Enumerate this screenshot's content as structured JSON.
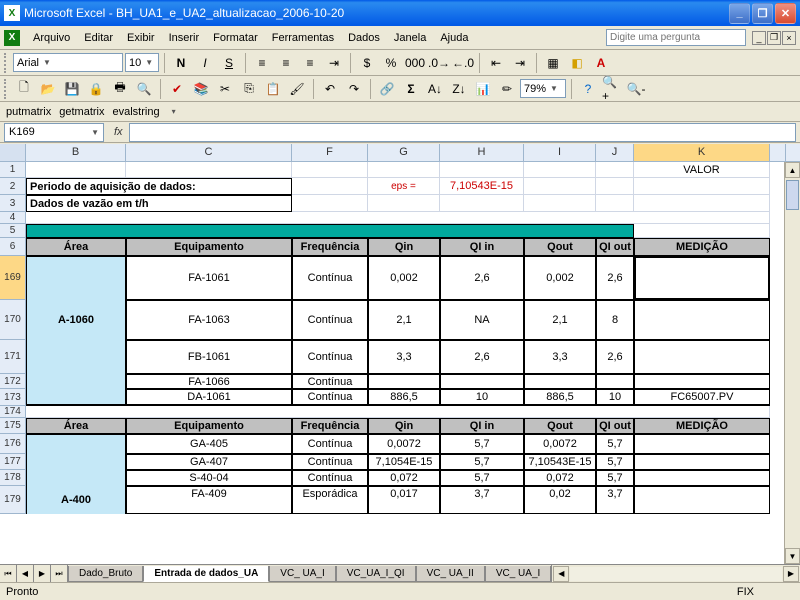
{
  "titlebar": {
    "app": "Microsoft Excel",
    "doc": "BH_UA1_e_UA2_altualizacao_2006-10-20"
  },
  "menu": {
    "arquivo": "Arquivo",
    "editar": "Editar",
    "exibir": "Exibir",
    "inserir": "Inserir",
    "formatar": "Formatar",
    "ferramentas": "Ferramentas",
    "dados": "Dados",
    "janela": "Janela",
    "ajuda": "Ajuda",
    "help_placeholder": "Digite uma pergunta"
  },
  "format_toolbar": {
    "font": "Arial",
    "size": "10"
  },
  "std_toolbar": {
    "zoom": "79%"
  },
  "custom_bar": {
    "a": "putmatrix",
    "b": "getmatrix",
    "c": "evalstring"
  },
  "namebox": "K169",
  "fx": "fx",
  "col_headers": [
    "B",
    "C",
    "F",
    "G",
    "H",
    "I",
    "J",
    "K"
  ],
  "rows": {
    "r1": {
      "k": "VALOR"
    },
    "r2": {
      "b": "Periodo de aquisição de dados:",
      "g": "eps =",
      "h": "7,10543E-15"
    },
    "r3": {
      "b": "Dados de vazão em t/h"
    },
    "hdr1": {
      "area": "Área",
      "equip": "Equipamento",
      "freq": "Frequência",
      "qin": "Qin",
      "qiin": "QI in",
      "qout": "Qout",
      "qiout": "QI out",
      "med": "MEDIÇÃO"
    },
    "r169": {
      "n": "169",
      "equip": "FA-1061",
      "freq": "Contínua",
      "qin": "0,002",
      "qiin": "2,6",
      "qout": "0,002",
      "qiout": "2,6"
    },
    "r170": {
      "n": "170",
      "area": "A-1060",
      "equip": "FA-1063",
      "freq": "Contínua",
      "qin": "2,1",
      "qiin": "NA",
      "qout": "2,1",
      "qiout": "8"
    },
    "r171": {
      "n": "171",
      "equip": "FB-1061",
      "freq": "Contínua",
      "qin": "3,3",
      "qiin": "2,6",
      "qout": "3,3",
      "qiout": "2,6"
    },
    "r172": {
      "n": "172",
      "equip": "FA-1066",
      "freq": "Contínua"
    },
    "r173": {
      "n": "173",
      "equip": "DA-1061",
      "freq": "Contínua",
      "qin": "886,5",
      "qiin": "10",
      "qout": "886,5",
      "qiout": "10",
      "med": "FC65007.PV"
    },
    "r174": {
      "n": "174"
    },
    "r175": {
      "n": "175"
    },
    "r176": {
      "n": "176",
      "equip": "GA-405",
      "freq": "Contínua",
      "qin": "0,0072",
      "qiin": "5,7",
      "qout": "0,0072",
      "qiout": "5,7"
    },
    "r177": {
      "n": "177",
      "equip": "GA-407",
      "freq": "Contínua",
      "qin": "7,1054E-15",
      "qiin": "5,7",
      "qout": "7,10543E-15",
      "qiout": "5,7"
    },
    "r178": {
      "n": "178",
      "equip": "S-40-04",
      "freq": "Contínua",
      "qin": "0,072",
      "qiin": "5,7",
      "qout": "0,072",
      "qiout": "5,7"
    },
    "r179": {
      "n": "179",
      "area": "A-400",
      "equip": "FA-409",
      "freq": "Esporádica",
      "qin": "0,017",
      "qiin": "3,7",
      "qout": "0,02",
      "qiout": "3,7"
    }
  },
  "row_nums": {
    "r1": "1",
    "r2": "2",
    "r3": "3",
    "r4": "4",
    "r5": "5",
    "r6": "6"
  },
  "tabs": {
    "t1": "Dado_Bruto",
    "t2": "Entrada de dados_UA",
    "t3": "VC_ UA_I",
    "t4": "VC_UA_I_QI",
    "t5": "VC_ UA_II",
    "t6": "VC_ UA_I"
  },
  "status": {
    "left": "Pronto",
    "right": "FIX"
  }
}
